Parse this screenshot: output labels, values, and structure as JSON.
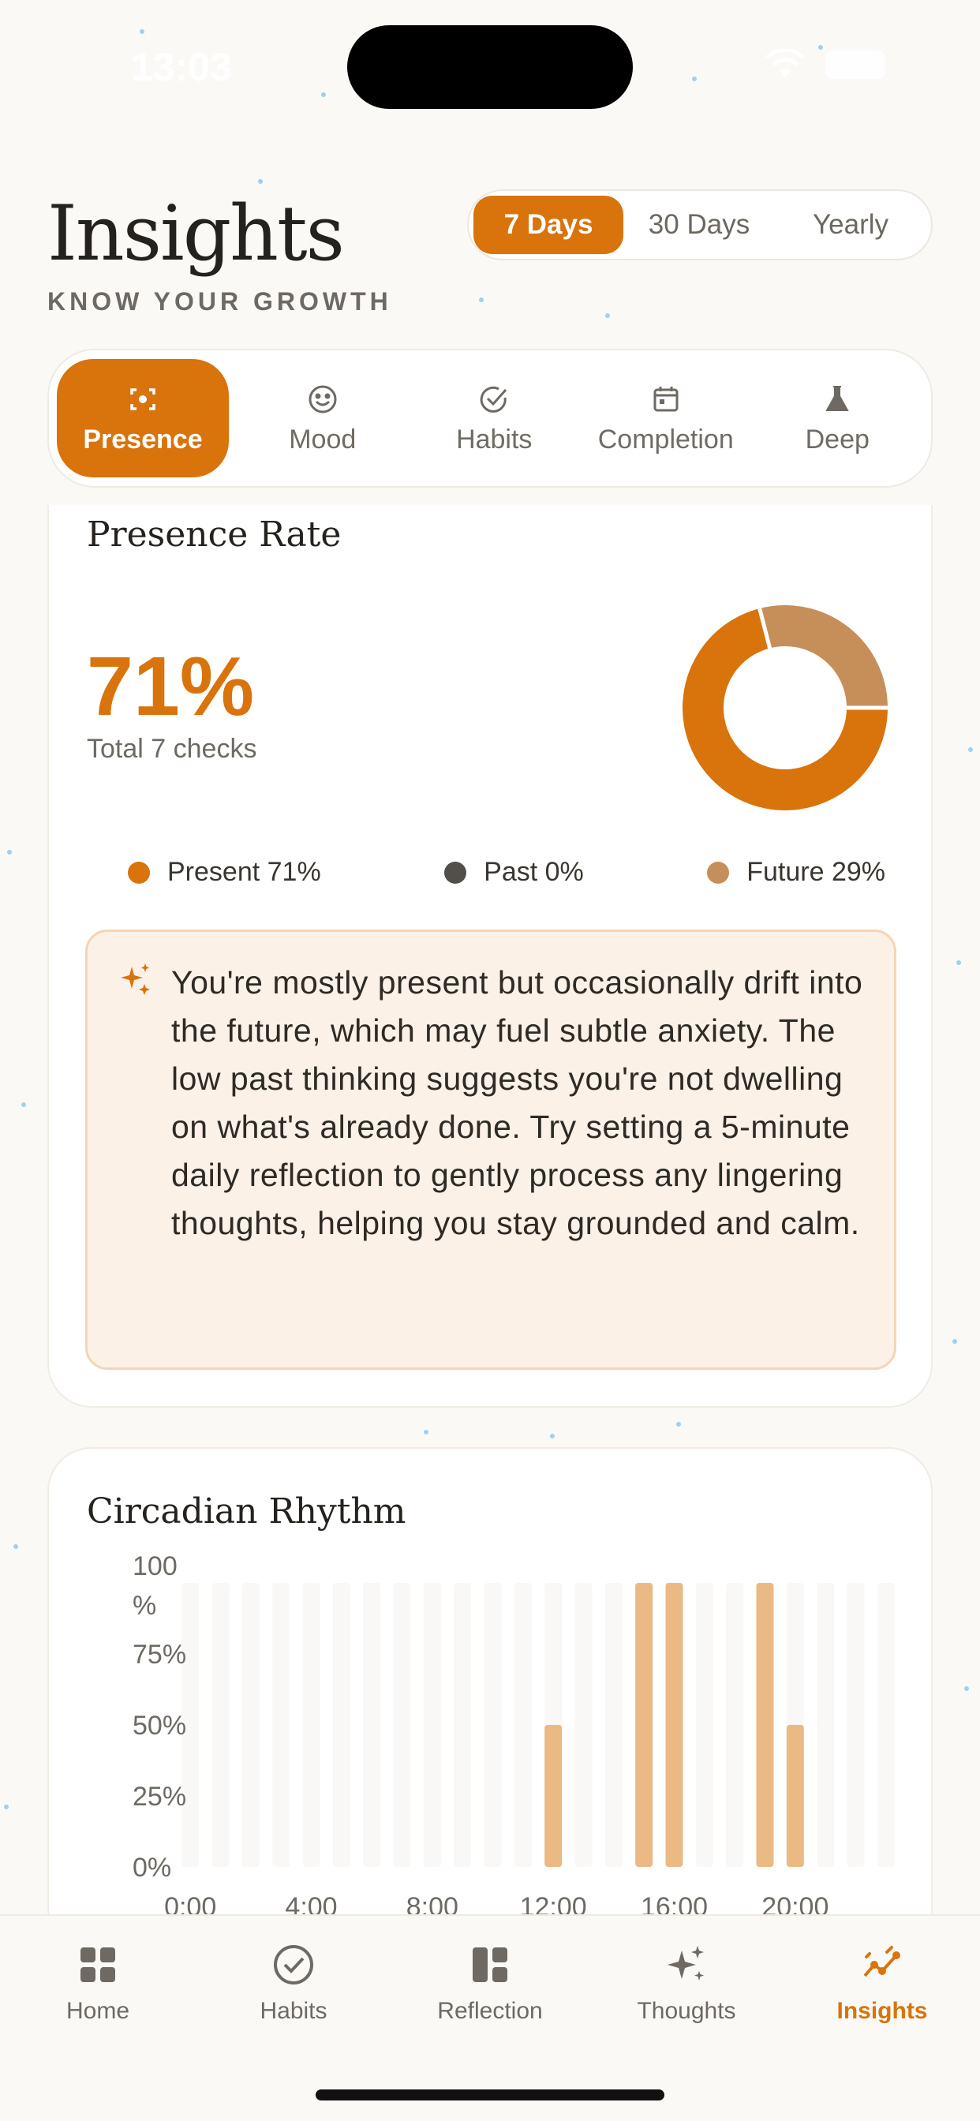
{
  "status_bar": {
    "time": "13:03"
  },
  "header": {
    "title": "Insights",
    "subtitle": "KNOW YOUR GROWTH"
  },
  "range": {
    "options": [
      "7 Days",
      "30 Days",
      "Yearly"
    ],
    "selected": "7 Days"
  },
  "tabs": [
    {
      "label": "Presence",
      "icon": "focus-icon",
      "active": true
    },
    {
      "label": "Mood",
      "icon": "smiley-icon",
      "active": false
    },
    {
      "label": "Habits",
      "icon": "check-circle-icon",
      "active": false
    },
    {
      "label": "Completion",
      "icon": "calendar-icon",
      "active": false
    },
    {
      "label": "Deep",
      "icon": "flask-icon",
      "active": false
    }
  ],
  "presence_card": {
    "title": "Presence Rate",
    "percent": "71%",
    "checks": "Total 7 checks",
    "legend": [
      {
        "label": "Present 71%",
        "color": "#d9730b"
      },
      {
        "label": "Past 0%",
        "color": "#524e49"
      },
      {
        "label": "Future 29%",
        "color": "#c68f5a"
      }
    ],
    "insight": "You're mostly present but occasionally drift into the future, which may fuel subtle anxiety. The low past thinking suggests you're not dwelling on what's already done. Try setting a 5-minute daily reflection to gently process any lingering thoughts, helping you stay grounded and calm."
  },
  "chart_data": [
    {
      "type": "pie",
      "categories": [
        "Present",
        "Past",
        "Future"
      ],
      "values": [
        71,
        0,
        29
      ],
      "colors": [
        "#d9730b",
        "#524e49",
        "#c68f5a"
      ],
      "donut": true
    },
    {
      "type": "bar",
      "title": "Circadian Rhythm",
      "hours": [
        0,
        1,
        2,
        3,
        4,
        5,
        6,
        7,
        8,
        9,
        10,
        11,
        12,
        13,
        14,
        15,
        16,
        17,
        18,
        19,
        20,
        21,
        22,
        23
      ],
      "values": [
        0,
        0,
        0,
        0,
        0,
        0,
        0,
        0,
        0,
        0,
        0,
        0,
        50,
        0,
        0,
        100,
        100,
        0,
        0,
        100,
        50,
        0,
        0,
        0
      ],
      "x_tick_labels": [
        "0:00",
        "4:00",
        "8:00",
        "12:00",
        "16:00",
        "20:00"
      ],
      "y_tick_labels": [
        "100\n%",
        "75%",
        "50%",
        "25%",
        "0%"
      ],
      "ylim": [
        0,
        100
      ],
      "bar_color": "#ebb984"
    }
  ],
  "bottom_nav": [
    {
      "label": "Home",
      "icon": "grid-icon",
      "active": false
    },
    {
      "label": "Habits",
      "icon": "check-circle-icon",
      "active": false
    },
    {
      "label": "Reflection",
      "icon": "layout-icon",
      "active": false
    },
    {
      "label": "Thoughts",
      "icon": "sparkles-icon",
      "active": false
    },
    {
      "label": "Insights",
      "icon": "trend-icon",
      "active": true
    }
  ]
}
